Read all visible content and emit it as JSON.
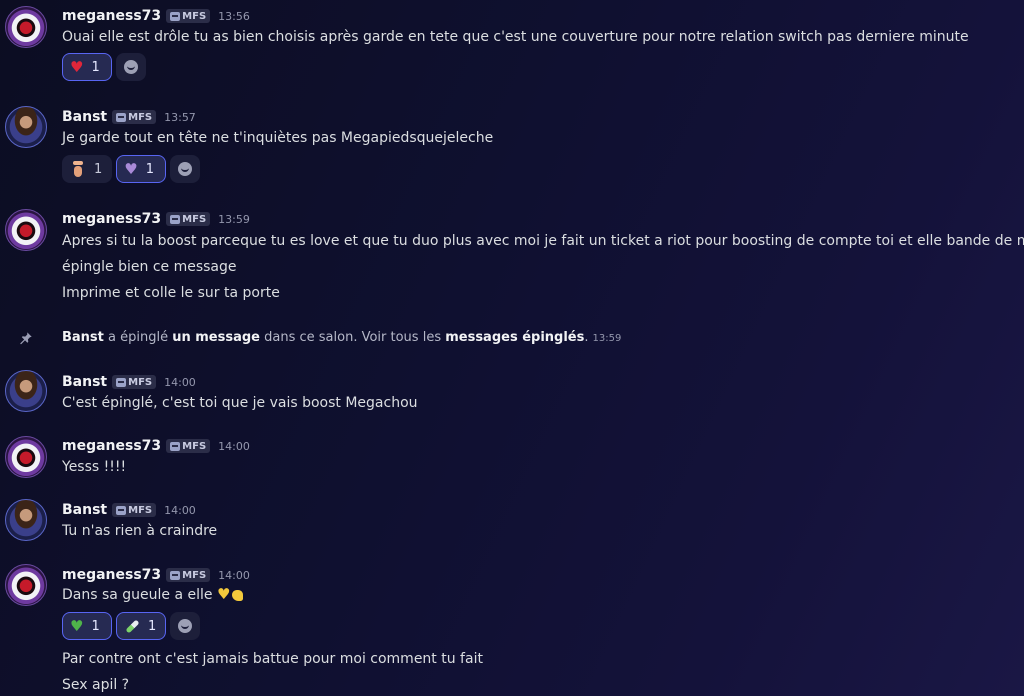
{
  "messages": [
    {
      "username": "meganess73",
      "tag": "MFS",
      "time": "13:56",
      "lines": [
        "Ouai elle est drôle tu as bien choisis après garde en tete que c'est une couverture pour notre relation switch pas derniere minute"
      ],
      "reactions": [
        {
          "emoji": "red-heart",
          "count": "1",
          "active": true
        }
      ]
    },
    {
      "username": "Banst",
      "tag": "MFS",
      "time": "13:57",
      "lines": [
        "Je garde tout en tête ne t'inquiètes pas Megapiedsquejeleche"
      ],
      "reactions": [
        {
          "emoji": "foot",
          "count": "1",
          "active": false
        },
        {
          "emoji": "purple-heart",
          "count": "1",
          "active": true
        }
      ]
    },
    {
      "username": "meganess73",
      "tag": "MFS",
      "time": "13:59",
      "lines": [
        "Apres si tu la boost parceque tu es love et que tu duo plus avec moi je fait un ticket a riot pour  boosting de compte toi et elle bande de merdes",
        "épingle bien ce message",
        "Imprime et colle le sur ta porte"
      ]
    },
    {
      "username": "Banst",
      "tag": "MFS",
      "time": "14:00",
      "lines": [
        "C'est épinglé, c'est toi que je vais boost Megachou"
      ]
    },
    {
      "username": "meganess73",
      "tag": "MFS",
      "time": "14:00",
      "lines": [
        "Yesss !!!!"
      ]
    },
    {
      "username": "Banst",
      "tag": "MFS",
      "time": "14:00",
      "lines": [
        "Tu n'as rien à craindre"
      ]
    },
    {
      "username": "meganess73",
      "tag": "MFS",
      "time": "14:00",
      "lines": [
        "Dans sa gueule a elle"
      ],
      "line_emojis": [
        "yellow-heart-hands",
        "flexed-biceps"
      ],
      "reactions": [
        {
          "emoji": "green-heart",
          "count": "1",
          "active": true
        },
        {
          "emoji": "pill",
          "count": "1",
          "active": true
        }
      ],
      "followups": [
        "Par contre ont c'est jamais battue pour moi comment tu fait",
        "Sex apil ?"
      ]
    }
  ],
  "system": {
    "actor": "Banst",
    "text1": " a épinglé ",
    "link1": "un message",
    "text2": " dans ce salon. Voir tous les ",
    "link2": "messages épinglés",
    "text3": ".",
    "time": "13:59",
    "icon": "pin-icon"
  },
  "colors": {
    "accent": "#5865f2",
    "background": "#0f1030"
  }
}
